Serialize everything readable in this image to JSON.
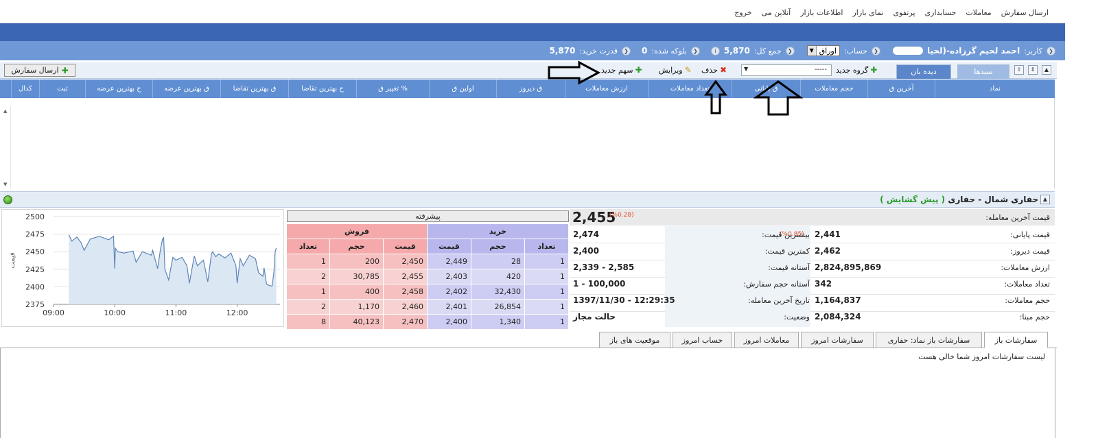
{
  "menu": {
    "items": [
      "ارسال سفارش",
      "معاملات",
      "حسابداری",
      "پرتفوی",
      "نمای بازار",
      "اطلاعات بازار",
      "آنلاین می",
      "خروج"
    ]
  },
  "info": {
    "user_label": "کاربر:",
    "user_name": "احمد لحیم گرزاده-(لحیا",
    "account_label": "حساب:",
    "account_value": "اوراق",
    "total_label": "جمع کل:",
    "total_value": "5,870",
    "blocked_label": "بلوکه شده:",
    "blocked_value": "0",
    "power_label": "قدرت خرید:",
    "power_value": "5,870"
  },
  "tabs": {
    "watch": "دیده بان",
    "basket": "سبدها"
  },
  "toolbar": {
    "new_group": "گروه جدید",
    "group_select": "-----",
    "delete": "حذف",
    "edit": "ویرایش",
    "new_stock": "سهم جدید",
    "send_order": "ارسال سفارش"
  },
  "grid_headers": [
    "نماد",
    "آخرین ق",
    "حجم معاملات",
    "ق پایانی",
    "تعداد معاملات",
    "ارزش معاملات",
    "ق دیروز",
    "اولین ق",
    "تغییر ق %",
    "ح بهترین تقاضا",
    "ق بهترین تقاضا",
    "ق بهترین عرضه",
    "ح بهترین عرضه",
    "ثبت",
    "کدال"
  ],
  "symbol": {
    "title": "حفاری شمال - حفاری",
    "status": "( پیش گشایش )"
  },
  "stats": {
    "last_price_label": "قیمت آخرین معامله:",
    "last_price": "2,455",
    "last_price_pct": "(%0.28)",
    "close_label": "قیمت پایانی:",
    "close": "2,441",
    "close_pct": "(%0.85)",
    "high_label": "بیشترین قیمت:",
    "high": "2,474",
    "yesterday_label": "قیمت دیروز:",
    "yesterday": "2,462",
    "low_label": "کمترین قیمت:",
    "low": "2,400",
    "value_label": "ارزش معاملات:",
    "value": "2,824,895,869",
    "band_label": "آستانه قیمت:",
    "band": "2,339 - 2,585",
    "count_label": "تعداد معاملات:",
    "count": "342",
    "vol_band_label": "آستانه حجم سفارش:",
    "vol_band": "1 - 100,000",
    "volume_label": "حجم معاملات:",
    "volume": "1,164,837",
    "last_date_label": "تاریخ آخرین معامله:",
    "last_date": "1397/11/30 - 12:29:35",
    "base_label": "حجم مبنا:",
    "base": "2,084,324",
    "state_label": "وضعیت:",
    "state": "حالت مجاز"
  },
  "book": {
    "advanced": "پیشرفته",
    "buy": "خرید",
    "sell": "فروش",
    "col_count": "تعداد",
    "col_vol": "حجم",
    "col_price": "قیمت",
    "rows": [
      {
        "buy_count": "1",
        "buy_vol": "28",
        "buy_price": "2,449",
        "sell_price": "2,450",
        "sell_vol": "200",
        "sell_count": "1"
      },
      {
        "buy_count": "1",
        "buy_vol": "420",
        "buy_price": "2,403",
        "sell_price": "2,455",
        "sell_vol": "30,785",
        "sell_count": "2"
      },
      {
        "buy_count": "1",
        "buy_vol": "32,430",
        "buy_price": "2,402",
        "sell_price": "2,458",
        "sell_vol": "400",
        "sell_count": "1"
      },
      {
        "buy_count": "1",
        "buy_vol": "26,854",
        "buy_price": "2,401",
        "sell_price": "2,460",
        "sell_vol": "1,170",
        "sell_count": "2"
      },
      {
        "buy_count": "1",
        "buy_vol": "1,340",
        "buy_price": "2,400",
        "sell_price": "2,470",
        "sell_vol": "40,123",
        "sell_count": "8"
      }
    ]
  },
  "chart_data": {
    "type": "area",
    "title": "",
    "xlabel": "",
    "ylabel": "قیمت",
    "xlim": [
      9.0,
      12.7
    ],
    "ylim": [
      2375,
      2500
    ],
    "yticks": [
      "2375",
      "2400",
      "2425",
      "2450",
      "2475",
      "2500"
    ],
    "xticks": [
      "09:00",
      "10:00",
      "11:00",
      "12:00"
    ],
    "color": "#5d84b8",
    "fill": "#dbe7f2",
    "x": [
      9.25,
      9.3,
      9.38,
      9.45,
      9.5,
      9.6,
      9.75,
      9.9,
      9.98,
      10.0,
      10.01,
      10.05,
      10.15,
      10.3,
      10.35,
      10.45,
      10.6,
      10.62,
      10.7,
      10.75,
      10.78,
      10.8,
      10.82,
      10.88,
      10.95,
      11.0,
      11.1,
      11.18,
      11.22,
      11.3,
      11.35,
      11.45,
      11.52,
      11.58,
      11.6,
      11.65,
      11.7,
      11.8,
      11.9,
      11.98,
      12.0,
      12.05,
      12.1,
      12.2,
      12.3,
      12.35,
      12.42,
      12.44,
      12.48,
      12.52,
      12.57,
      12.6,
      12.62,
      12.64
    ],
    "y": [
      2474,
      2465,
      2471,
      2463,
      2452,
      2468,
      2472,
      2467,
      2472,
      2426,
      2455,
      2450,
      2448,
      2451,
      2435,
      2450,
      2445,
      2452,
      2426,
      2455,
      2468,
      2470,
      2425,
      2410,
      2442,
      2438,
      2442,
      2430,
      2405,
      2444,
      2430,
      2438,
      2407,
      2447,
      2450,
      2443,
      2447,
      2441,
      2448,
      2430,
      2405,
      2440,
      2430,
      2445,
      2440,
      2420,
      2415,
      2427,
      2404,
      2402,
      2401,
      2420,
      2450,
      2455
    ]
  },
  "bottom_tabs": [
    "سفارشات باز",
    "سفارشات باز نماد: حفاری",
    "سفارشات امروز",
    "معاملات امروز",
    "حساب امروز",
    "موقعیت های باز"
  ],
  "bottom_message": "لیست سفارشات امروز شما خالی هست"
}
